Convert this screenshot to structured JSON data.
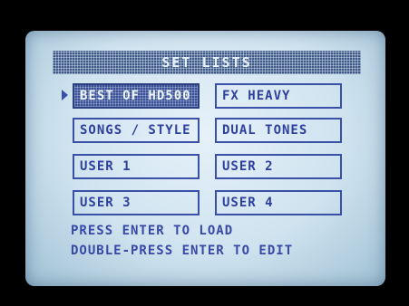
{
  "header": {
    "title": "SET LISTS"
  },
  "setlists": [
    {
      "label": "BEST OF HD500",
      "selected": true
    },
    {
      "label": "FX HEAVY",
      "selected": false
    },
    {
      "label": "SONGS / STYLE",
      "selected": false
    },
    {
      "label": "DUAL TONES",
      "selected": false
    },
    {
      "label": "USER 1",
      "selected": false
    },
    {
      "label": "USER 2",
      "selected": false
    },
    {
      "label": "USER 3",
      "selected": false
    },
    {
      "label": "USER 4",
      "selected": false
    }
  ],
  "footer": {
    "line1": "PRESS ENTER TO LOAD",
    "line2": "DOUBLE-PRESS ENTER TO EDIT"
  },
  "colors": {
    "screen": "#d6e8f3",
    "text": "#2e3f9c",
    "highlight": "#3b4f94"
  }
}
